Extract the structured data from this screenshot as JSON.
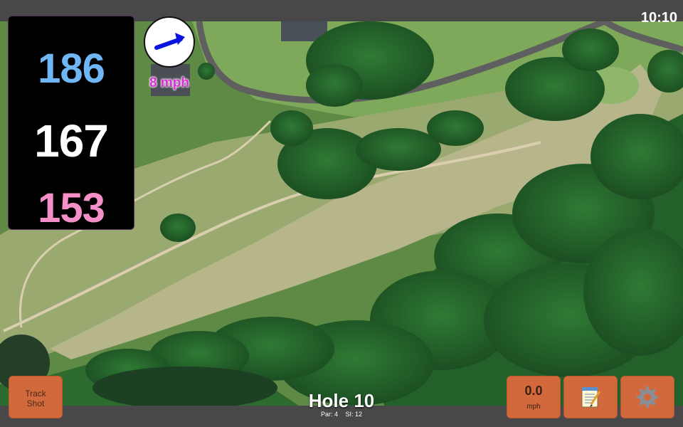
{
  "status": {
    "clock": "10:10"
  },
  "distances": {
    "back": "186",
    "middle": "167",
    "front": "153"
  },
  "wind": {
    "speed": "8 mph",
    "direction_icon": "arrow-up-right"
  },
  "buttons": {
    "track_shot_line1": "Track",
    "track_shot_line2": "Shot",
    "speed_value": "0.0",
    "speed_unit": "mph",
    "notes_icon": "notepad-icon",
    "settings_icon": "gear-icon"
  },
  "hole": {
    "title": "Hole 10",
    "par": "Par: 4",
    "si": "SI: 12"
  },
  "colors": {
    "back_distance": "#6fb6f5",
    "middle_distance": "#ffffff",
    "front_distance": "#f58fc7",
    "wind_text": "#d92fd0",
    "button": "#d2693c"
  }
}
